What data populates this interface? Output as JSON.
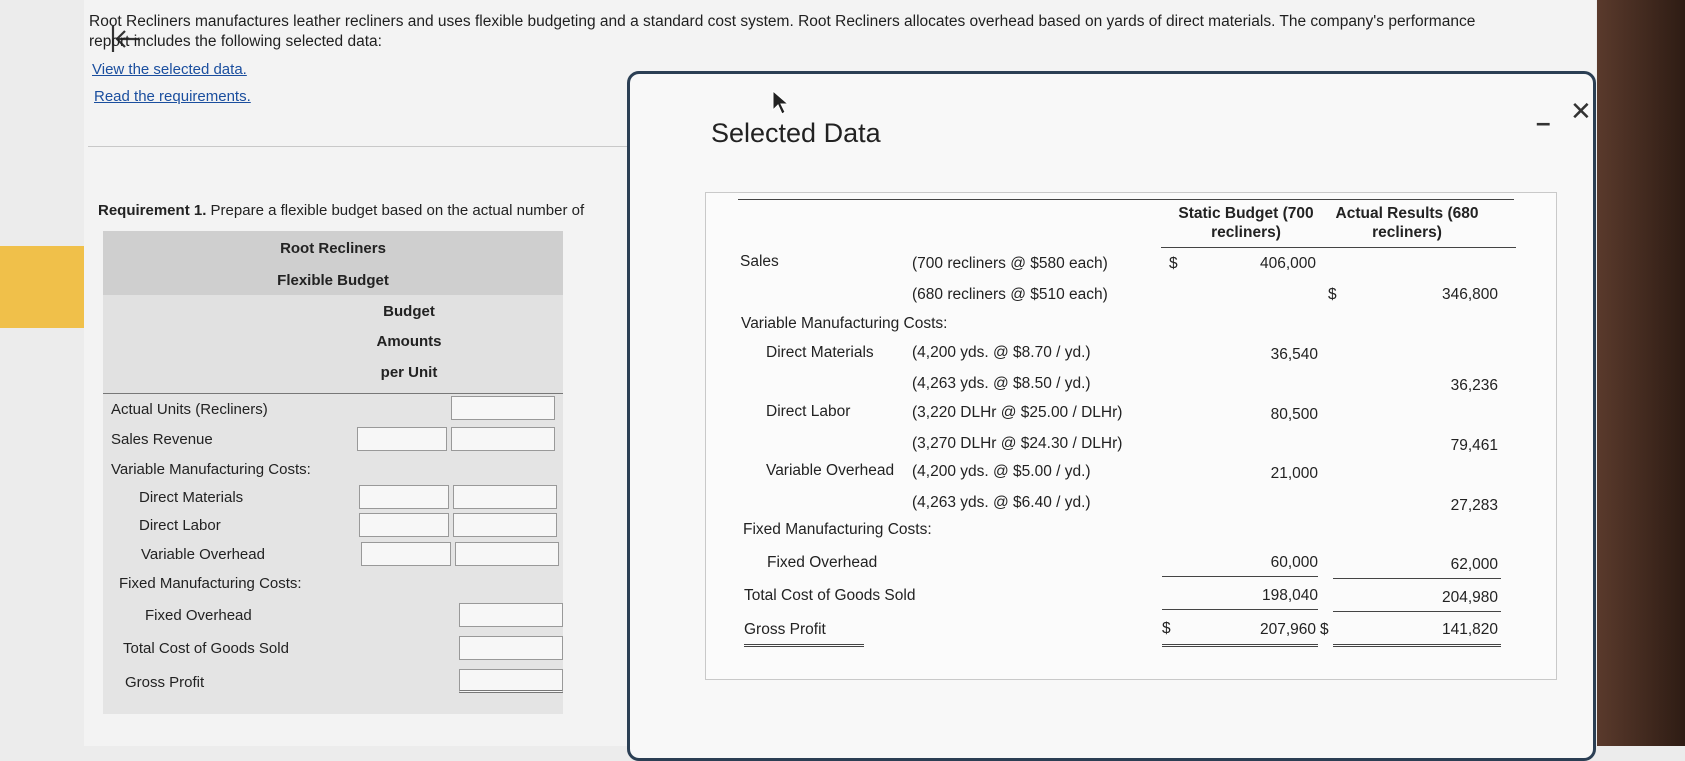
{
  "intro_text": "Root Recliners manufactures leather recliners and uses flexible budgeting and a standard cost system. Root Recliners allocates overhead based on yards of direct materials. The company's performance report includes the following selected data:",
  "links": {
    "view_data": "View the selected data.",
    "read_requirements": "Read the requirements."
  },
  "requirement": {
    "label": "Requirement 1.",
    "text": "Prepare a flexible budget based on the actual number of"
  },
  "flexible_budget": {
    "company": "Root Recliners",
    "title": "Flexible Budget",
    "col_header": [
      "Budget",
      "Amounts",
      "per Unit"
    ],
    "rows": {
      "actual_units": "Actual Units (Recliners)",
      "sales_revenue": "Sales Revenue",
      "variable_costs": "Variable Manufacturing Costs:",
      "direct_materials": "Direct Materials",
      "direct_labor": "Direct Labor",
      "variable_overhead": "Variable Overhead",
      "fixed_costs": "Fixed Manufacturing Costs:",
      "fixed_overhead": "Fixed Overhead",
      "total_cogs": "Total Cost of Goods Sold",
      "gross_profit": "Gross Profit"
    }
  },
  "modal": {
    "title": "Selected Data",
    "headers": {
      "static": "Static Budget (700 recliners)",
      "actual": "Actual Results (680 recliners)"
    },
    "rows": {
      "sales_label": "Sales",
      "sales_static_desc": "(700 recliners @ $580 each)",
      "sales_static_sign": "$",
      "sales_static_val": "406,000",
      "sales_actual_desc": "(680 recliners @ $510 each)",
      "sales_actual_sign": "$",
      "sales_actual_val": "346,800",
      "vmc_label": "Variable Manufacturing Costs:",
      "dm_label": "Direct Materials",
      "dm_static_desc": "(4,200 yds. @ $8.70 / yd.)",
      "dm_static_val": "36,540",
      "dm_actual_desc": "(4,263 yds. @ $8.50 / yd.)",
      "dm_actual_val": "36,236",
      "dl_label": "Direct Labor",
      "dl_static_desc": "(3,220 DLHr @ $25.00 / DLHr)",
      "dl_static_val": "80,500",
      "dl_actual_desc": "(3,270 DLHr @ $24.30 / DLHr)",
      "dl_actual_val": "79,461",
      "vo_label": "Variable Overhead",
      "vo_static_desc": "(4,200 yds. @ $5.00 / yd.)",
      "vo_static_val": "21,000",
      "vo_actual_desc": "(4,263 yds. @ $6.40 / yd.)",
      "vo_actual_val": "27,283",
      "fmc_label": "Fixed Manufacturing Costs:",
      "fo_label": "Fixed Overhead",
      "fo_static_val": "60,000",
      "fo_actual_val": "62,000",
      "tcogs_label": "Total Cost of Goods Sold",
      "tcogs_static_val": "198,040",
      "tcogs_actual_val": "204,980",
      "gp_label": "Gross Profit",
      "gp_static_sign": "$",
      "gp_static_val": "207,960",
      "gp_actual_sign": "$",
      "gp_actual_val": "141,820"
    },
    "minimize": "–",
    "close": "✕"
  }
}
